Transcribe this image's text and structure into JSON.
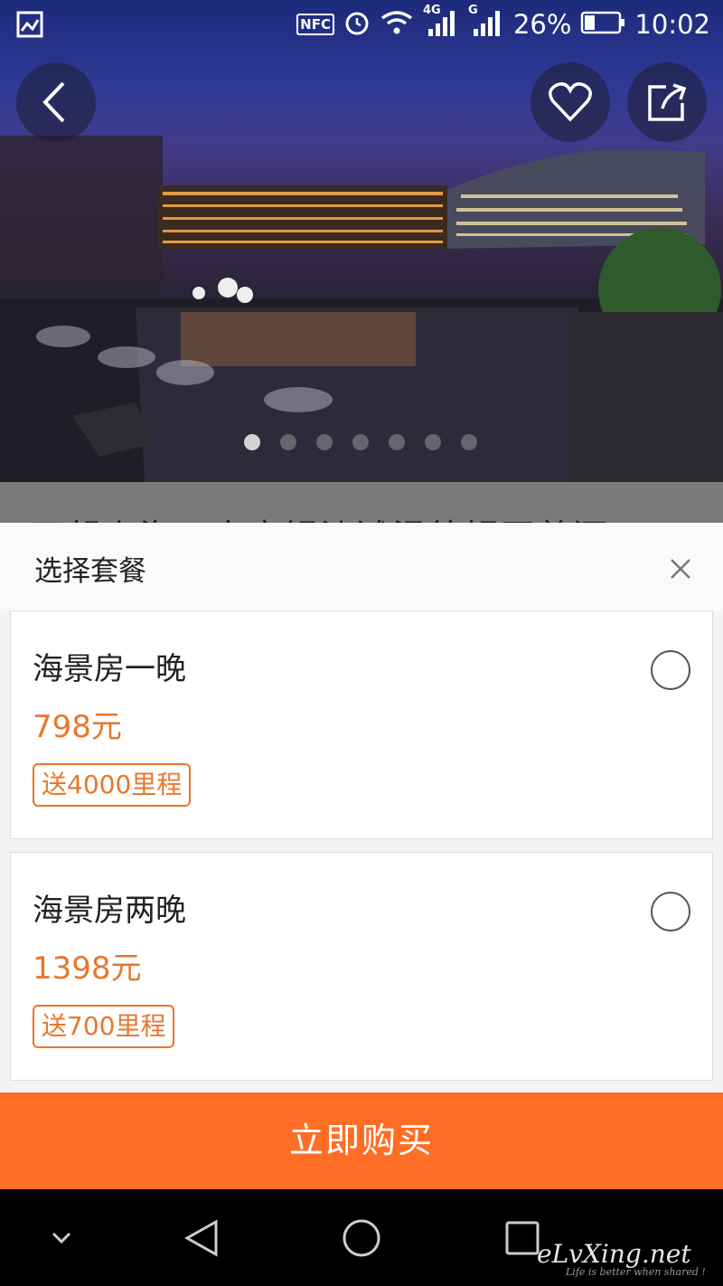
{
  "status_bar": {
    "nfc_label": "NFC",
    "net1_label": "4G",
    "net2_label": "G",
    "battery": "26%",
    "time": "10:02"
  },
  "hero": {
    "current_slide": 1,
    "slide_count": 7,
    "back_icon": "chevron-left-icon",
    "favorite_icon": "heart-icon",
    "share_icon": "share-icon"
  },
  "underlying_page": {
    "title_fragment": "万起上海！春良银沙滩温德姆至尊酒"
  },
  "sheet": {
    "title": "选择套餐",
    "close_icon": "close-icon",
    "packages": [
      {
        "name": "海景房一晚",
        "price": "798元",
        "badge": "送4000里程",
        "selected": false
      },
      {
        "name": "海景房两晚",
        "price": "1398元",
        "badge": "送700里程",
        "selected": false
      }
    ]
  },
  "buy_button": {
    "label": "立即购买"
  },
  "nav_bar": {
    "items": [
      "chevron-down-icon",
      "back-triangle-icon",
      "home-circle-icon",
      "recents-square-icon"
    ]
  },
  "watermark": {
    "main": "eLvXing.net",
    "sub": "Life is better when shared !"
  },
  "colors": {
    "accent": "#ff6e26",
    "price": "#e8772d"
  }
}
